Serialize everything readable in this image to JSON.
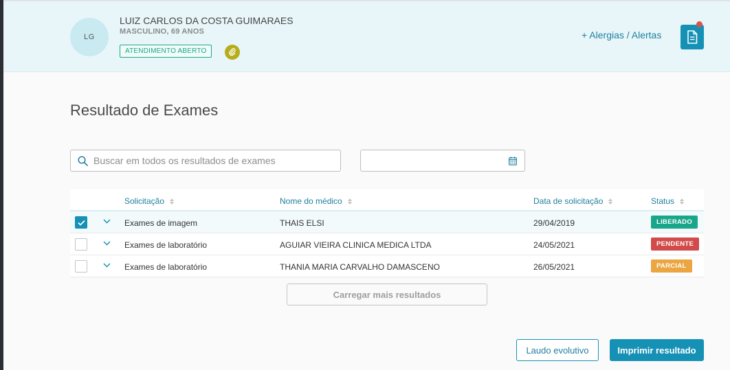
{
  "colors": {
    "primary": "#1591b5",
    "header_bg": "#e8f6f9",
    "status_open": "#1aa68a",
    "liberado": "#1aa68a",
    "pendente": "#d24a4a",
    "parcial": "#eba541"
  },
  "patient": {
    "initials": "LG",
    "name": "LUIZ CARLOS DA COSTA GUIMARAES",
    "info": "MASCULINO, 69 ANOS",
    "status": "ATENDIMENTO ABERTO",
    "attachment_icon": "paperclip-icon"
  },
  "header": {
    "allergy_link": "+ Alergias / Alertas",
    "doc_icon": "document-icon"
  },
  "page": {
    "title": "Resultado de Exames"
  },
  "search": {
    "placeholder": "Buscar em todos os resultados de exames",
    "value": ""
  },
  "date_filter": {
    "value": "",
    "icon": "calendar-icon"
  },
  "table": {
    "columns": [
      "Solicitação",
      "Nome do médico",
      "Data de solicitação",
      "Status"
    ],
    "rows": [
      {
        "checked": true,
        "solicitacao": "Exames de imagem",
        "medico": "THAIS ELSI",
        "data": "29/04/2019",
        "status": "LIBERADO"
      },
      {
        "checked": false,
        "solicitacao": "Exames de laboratório",
        "medico": "AGUIAR VIEIRA CLINICA MEDICA LTDA",
        "data": "24/05/2021",
        "status": "PENDENTE"
      },
      {
        "checked": false,
        "solicitacao": "Exames de laboratório",
        "medico": "THANIA MARIA CARVALHO DAMASCENO",
        "data": "26/05/2021",
        "status": "PARCIAL"
      }
    ]
  },
  "actions": {
    "load_more": "Carregar mais resultados",
    "laudo": "Laudo evolutivo",
    "imprimir": "Imprimir resultado"
  }
}
